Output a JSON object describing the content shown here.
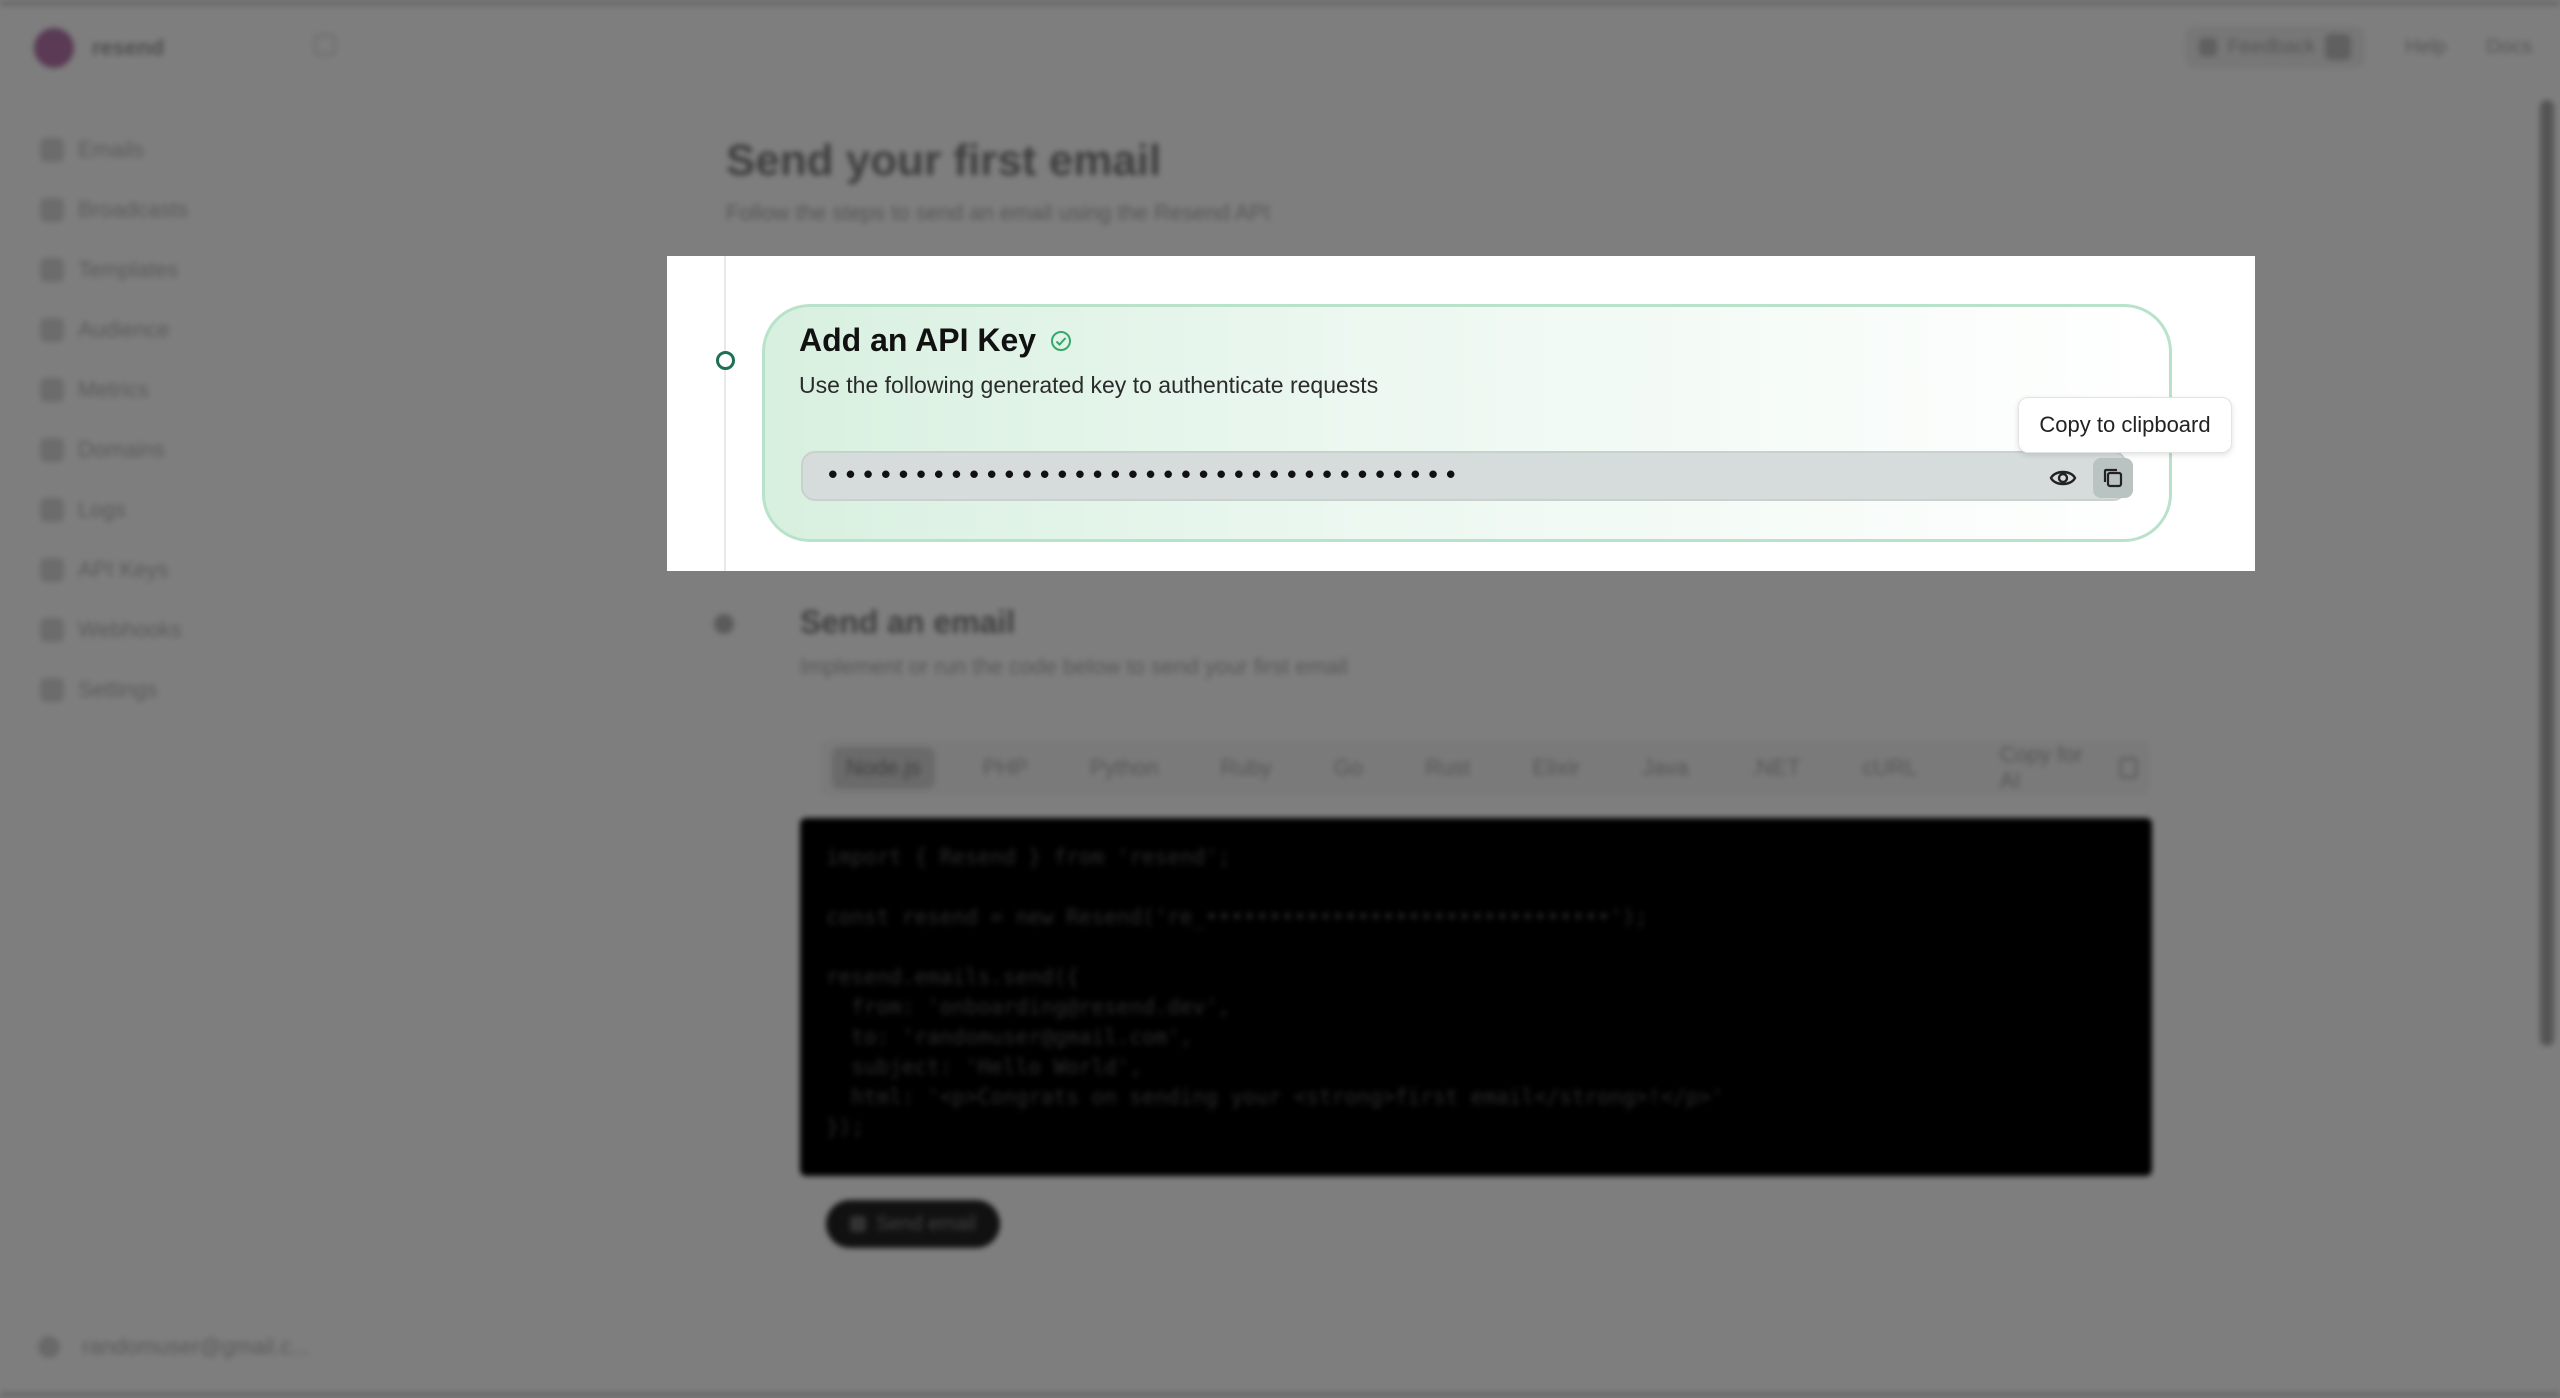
{
  "app": {
    "brand_name": "resend"
  },
  "topbar": {
    "feedback_label": "Feedback",
    "help_label": "Help",
    "docs_label": "Docs"
  },
  "sidebar": {
    "items": [
      {
        "label": "Emails",
        "icon": "mail-icon"
      },
      {
        "label": "Broadcasts",
        "icon": "megaphone-icon"
      },
      {
        "label": "Templates",
        "icon": "template-icon"
      },
      {
        "label": "Audience",
        "icon": "users-icon"
      },
      {
        "label": "Metrics",
        "icon": "chart-icon"
      },
      {
        "label": "Domains",
        "icon": "globe-icon"
      },
      {
        "label": "Logs",
        "icon": "list-icon"
      },
      {
        "label": "API Keys",
        "icon": "key-icon"
      },
      {
        "label": "Webhooks",
        "icon": "webhook-icon"
      },
      {
        "label": "Settings",
        "icon": "gear-icon"
      }
    ],
    "user_email": "randomuser@gmail.c..."
  },
  "page": {
    "title": "Send your first email",
    "subtitle": "Follow the steps to send an email using the Resend API"
  },
  "step1": {
    "title": "Add an API Key",
    "description": "Use the following generated key to authenticate requests",
    "key_masked": "••••••••••••••••••••••••••••••••••••",
    "tooltip": "Copy to clipboard"
  },
  "step2": {
    "title": "Send an email",
    "description": "Implement or run the code below to send your first email",
    "tabs": [
      "Node.js",
      "PHP",
      "Python",
      "Ruby",
      "Go",
      "Rust",
      "Elixir",
      "Java",
      ".NET",
      "cURL"
    ],
    "active_tab": "Node.js",
    "copy_as_label": "Copy for AI",
    "code_lines": [
      "import { Resend } from 'resend';",
      "",
      "const resend = new Resend('re_••••••••••••••••••••••••••••••••');",
      "",
      "resend.emails.send({",
      "  from: 'onboarding@resend.dev',",
      "  to: 'randomuser@gmail.com',",
      "  subject: 'Hello World',",
      "  html: '<p>Congrats on sending your <strong>first email</strong>!</p>'",
      "});"
    ],
    "send_label": "Send email"
  },
  "colors": {
    "accent_green": "#1f6f55",
    "card_border": "#b8e2c9",
    "overlay": "#7f7f7f"
  }
}
